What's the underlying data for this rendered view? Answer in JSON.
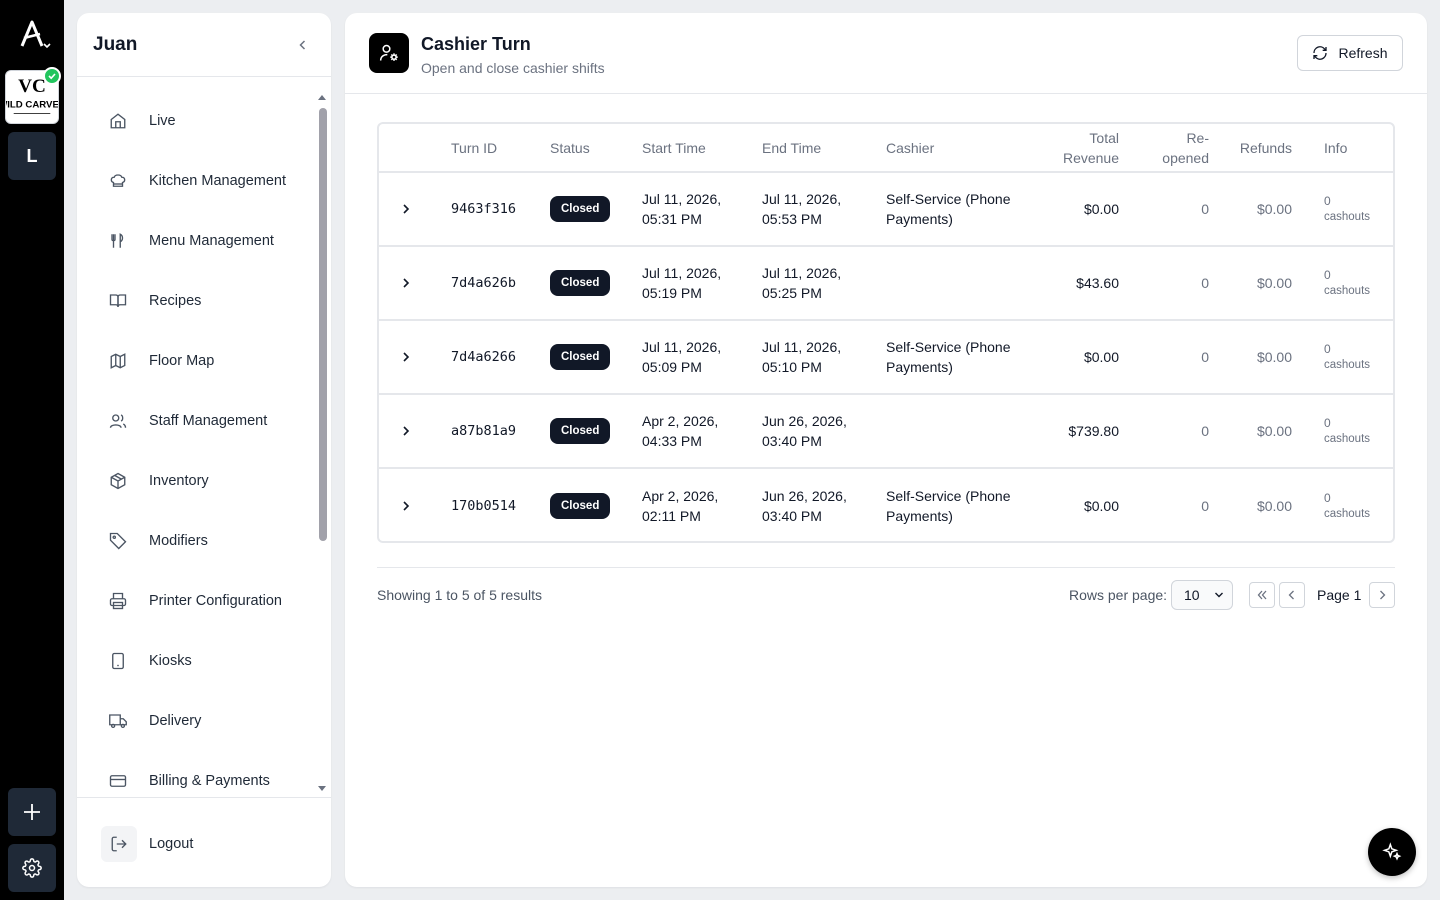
{
  "rail": {
    "workspace_letter": "L",
    "brand_logo": "wild-carver-logo"
  },
  "sidebar": {
    "title": "Juan",
    "items": [
      {
        "label": "Live",
        "icon": "home-icon"
      },
      {
        "label": "Kitchen Management",
        "icon": "chef-hat-icon"
      },
      {
        "label": "Menu Management",
        "icon": "utensils-icon"
      },
      {
        "label": "Recipes",
        "icon": "book-open-icon"
      },
      {
        "label": "Floor Map",
        "icon": "map-icon"
      },
      {
        "label": "Staff Management",
        "icon": "users-icon"
      },
      {
        "label": "Inventory",
        "icon": "package-icon"
      },
      {
        "label": "Modifiers",
        "icon": "tag-icon"
      },
      {
        "label": "Printer Configuration",
        "icon": "printer-icon"
      },
      {
        "label": "Kiosks",
        "icon": "tablet-icon"
      },
      {
        "label": "Delivery",
        "icon": "truck-icon"
      },
      {
        "label": "Billing & Payments",
        "icon": "credit-card-icon"
      }
    ],
    "logout_label": "Logout"
  },
  "header": {
    "title": "Cashier Turn",
    "subtitle": "Open and close cashier shifts",
    "refresh_label": "Refresh"
  },
  "table": {
    "columns": {
      "turn_id": "Turn ID",
      "status": "Status",
      "start_time": "Start Time",
      "end_time": "End Time",
      "cashier": "Cashier",
      "total_revenue_1": "Total",
      "total_revenue_2": "Revenue",
      "reopened_1": "Re-",
      "reopened_2": "opened",
      "refunds": "Refunds",
      "info": "Info"
    },
    "rows": [
      {
        "id": "9463f316",
        "status": "Closed",
        "start_1": "Jul 11, 2026,",
        "start_2": "05:31 PM",
        "end_1": "Jul 11, 2026,",
        "end_2": "05:53 PM",
        "cashier_1": "Self-Service (Phone",
        "cashier_2": "Payments)",
        "revenue": "$0.00",
        "reopened": "0",
        "refunds": "$0.00",
        "info_count": "0",
        "info_label": "cashouts"
      },
      {
        "id": "7d4a626b",
        "status": "Closed",
        "start_1": "Jul 11, 2026,",
        "start_2": "05:19 PM",
        "end_1": "Jul 11, 2026,",
        "end_2": "05:25 PM",
        "cashier_1": "",
        "cashier_2": "",
        "revenue": "$43.60",
        "reopened": "0",
        "refunds": "$0.00",
        "info_count": "0",
        "info_label": "cashouts"
      },
      {
        "id": "7d4a6266",
        "status": "Closed",
        "start_1": "Jul 11, 2026,",
        "start_2": "05:09 PM",
        "end_1": "Jul 11, 2026,",
        "end_2": "05:10 PM",
        "cashier_1": "Self-Service (Phone",
        "cashier_2": "Payments)",
        "revenue": "$0.00",
        "reopened": "0",
        "refunds": "$0.00",
        "info_count": "0",
        "info_label": "cashouts"
      },
      {
        "id": "a87b81a9",
        "status": "Closed",
        "start_1": "Apr 2, 2026,",
        "start_2": "04:33 PM",
        "end_1": "Jun 26, 2026,",
        "end_2": "03:40 PM",
        "cashier_1": "",
        "cashier_2": "",
        "revenue": "$739.80",
        "reopened": "0",
        "refunds": "$0.00",
        "info_count": "0",
        "info_label": "cashouts"
      },
      {
        "id": "170b0514",
        "status": "Closed",
        "start_1": "Apr 2, 2026,",
        "start_2": "02:11 PM",
        "end_1": "Jun 26, 2026,",
        "end_2": "03:40 PM",
        "cashier_1": "Self-Service (Phone",
        "cashier_2": "Payments)",
        "revenue": "$0.00",
        "reopened": "0",
        "refunds": "$0.00",
        "info_count": "0",
        "info_label": "cashouts"
      }
    ]
  },
  "pagination": {
    "showing_text": "Showing 1 to 5 of 5 results",
    "rows_per_page_label": "Rows per page:",
    "rows_per_page_value": "10",
    "page_label": "Page 1"
  },
  "colors": {
    "badge_bg": "#111827",
    "rail_bg": "#000000",
    "success_check": "#22c55e"
  }
}
